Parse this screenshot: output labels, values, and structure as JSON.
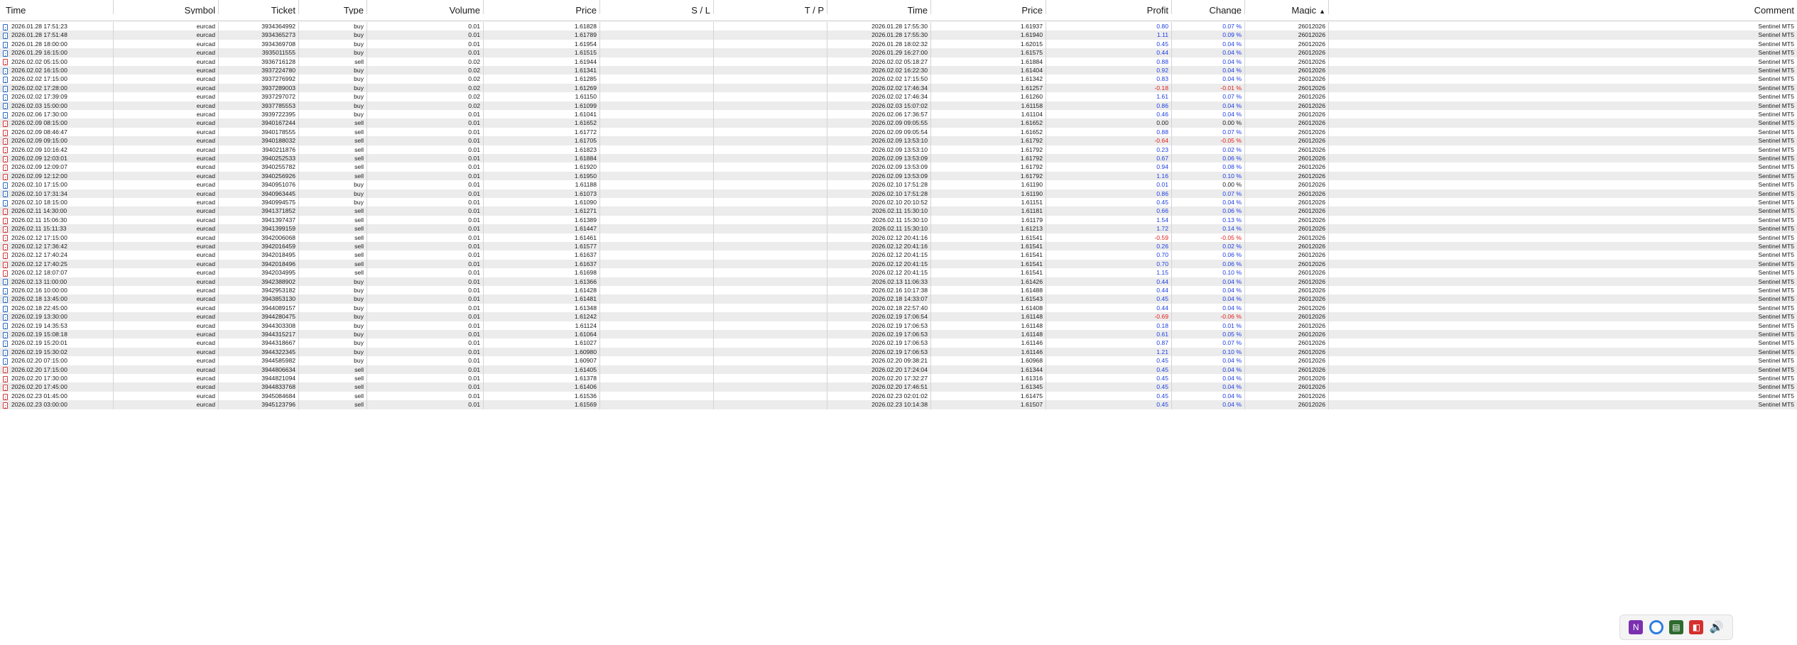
{
  "columns": {
    "time": "Time",
    "symbol": "Symbol",
    "ticket": "Ticket",
    "type": "Type",
    "volume": "Volume",
    "price": "Price",
    "sl": "S / L",
    "tp": "T / P",
    "close_time": "Time",
    "close_price": "Price",
    "profit": "Profit",
    "change": "Change",
    "magic": "Magic",
    "comment": "Comment",
    "sort_indicator": "▲"
  },
  "rows": [
    {
      "time": "2026.01.28 17:51:23",
      "symbol": "eurcad",
      "ticket": "3934364992",
      "type": "buy",
      "volume": "0.01",
      "price": "1.61828",
      "sl": "",
      "tp": "",
      "close_time": "2026.01.28 17:55:30",
      "close_price": "1.61937",
      "profit": "0.80",
      "change": "0.07 %",
      "magic": "26012026",
      "comment": "Sentinel MT5"
    },
    {
      "time": "2026.01.28 17:51:48",
      "symbol": "eurcad",
      "ticket": "3934365273",
      "type": "buy",
      "volume": "0.01",
      "price": "1.61789",
      "sl": "",
      "tp": "",
      "close_time": "2026.01.28 17:55:30",
      "close_price": "1.61940",
      "profit": "1.11",
      "change": "0.09 %",
      "magic": "26012026",
      "comment": "Sentinel MT5"
    },
    {
      "time": "2026.01.28 18:00:00",
      "symbol": "eurcad",
      "ticket": "3934369708",
      "type": "buy",
      "volume": "0.01",
      "price": "1.61954",
      "sl": "",
      "tp": "",
      "close_time": "2026.01.28 18:02:32",
      "close_price": "1.62015",
      "profit": "0.45",
      "change": "0.04 %",
      "magic": "26012026",
      "comment": "Sentinel MT5"
    },
    {
      "time": "2026.01.29 16:15:00",
      "symbol": "eurcad",
      "ticket": "3935011555",
      "type": "buy",
      "volume": "0.01",
      "price": "1.61515",
      "sl": "",
      "tp": "",
      "close_time": "2026.01.29 16:27:00",
      "close_price": "1.61575",
      "profit": "0.44",
      "change": "0.04 %",
      "magic": "26012026",
      "comment": "Sentinel MT5"
    },
    {
      "time": "2026.02.02 05:15:00",
      "symbol": "eurcad",
      "ticket": "3936716128",
      "type": "sell",
      "volume": "0.02",
      "price": "1.61944",
      "sl": "",
      "tp": "",
      "close_time": "2026.02.02 05:18:27",
      "close_price": "1.61884",
      "profit": "0.88",
      "change": "0.04 %",
      "magic": "26012026",
      "comment": "Sentinel MT5"
    },
    {
      "time": "2026.02.02 16:15:00",
      "symbol": "eurcad",
      "ticket": "3937224780",
      "type": "buy",
      "volume": "0.02",
      "price": "1.61341",
      "sl": "",
      "tp": "",
      "close_time": "2026.02.02 16:22:30",
      "close_price": "1.61404",
      "profit": "0.92",
      "change": "0.04 %",
      "magic": "26012026",
      "comment": "Sentinel MT5"
    },
    {
      "time": "2026.02.02 17:15:00",
      "symbol": "eurcad",
      "ticket": "3937276992",
      "type": "buy",
      "volume": "0.02",
      "price": "1.61285",
      "sl": "",
      "tp": "",
      "close_time": "2026.02.02 17:15:50",
      "close_price": "1.61342",
      "profit": "0.83",
      "change": "0.04 %",
      "magic": "26012026",
      "comment": "Sentinel MT5"
    },
    {
      "time": "2026.02.02 17:28:00",
      "symbol": "eurcad",
      "ticket": "3937289003",
      "type": "buy",
      "volume": "0.02",
      "price": "1.61269",
      "sl": "",
      "tp": "",
      "close_time": "2026.02.02 17:46:34",
      "close_price": "1.61257",
      "profit": "-0.18",
      "change": "-0.01 %",
      "magic": "26012026",
      "comment": "Sentinel MT5"
    },
    {
      "time": "2026.02.02 17:39:09",
      "symbol": "eurcad",
      "ticket": "3937297072",
      "type": "buy",
      "volume": "0.02",
      "price": "1.61150",
      "sl": "",
      "tp": "",
      "close_time": "2026.02.02 17:46:34",
      "close_price": "1.61260",
      "profit": "1.61",
      "change": "0.07 %",
      "magic": "26012026",
      "comment": "Sentinel MT5"
    },
    {
      "time": "2026.02.03 15:00:00",
      "symbol": "eurcad",
      "ticket": "3937785553",
      "type": "buy",
      "volume": "0.02",
      "price": "1.61099",
      "sl": "",
      "tp": "",
      "close_time": "2026.02.03 15:07:02",
      "close_price": "1.61158",
      "profit": "0.86",
      "change": "0.04 %",
      "magic": "26012026",
      "comment": "Sentinel MT5"
    },
    {
      "time": "2026.02.06 17:30:00",
      "symbol": "eurcad",
      "ticket": "3939722395",
      "type": "buy",
      "volume": "0.01",
      "price": "1.61041",
      "sl": "",
      "tp": "",
      "close_time": "2026.02.06 17:36:57",
      "close_price": "1.61104",
      "profit": "0.46",
      "change": "0.04 %",
      "magic": "26012026",
      "comment": "Sentinel MT5"
    },
    {
      "time": "2026.02.09 08:15:00",
      "symbol": "eurcad",
      "ticket": "3940167244",
      "type": "sell",
      "volume": "0.01",
      "price": "1.61652",
      "sl": "",
      "tp": "",
      "close_time": "2026.02.09 09:05:55",
      "close_price": "1.61652",
      "profit": "0.00",
      "change": "0.00 %",
      "magic": "26012026",
      "comment": "Sentinel MT5"
    },
    {
      "time": "2026.02.09 08:46:47",
      "symbol": "eurcad",
      "ticket": "3940178555",
      "type": "sell",
      "volume": "0.01",
      "price": "1.61772",
      "sl": "",
      "tp": "",
      "close_time": "2026.02.09 09:05:54",
      "close_price": "1.61652",
      "profit": "0.88",
      "change": "0.07 %",
      "magic": "26012026",
      "comment": "Sentinel MT5"
    },
    {
      "time": "2026.02.09 09:15:00",
      "symbol": "eurcad",
      "ticket": "3940188032",
      "type": "sell",
      "volume": "0.01",
      "price": "1.61705",
      "sl": "",
      "tp": "",
      "close_time": "2026.02.09 13:53:10",
      "close_price": "1.61792",
      "profit": "-0.64",
      "change": "-0.05 %",
      "magic": "26012026",
      "comment": "Sentinel MT5"
    },
    {
      "time": "2026.02.09 10:16:42",
      "symbol": "eurcad",
      "ticket": "3940211876",
      "type": "sell",
      "volume": "0.01",
      "price": "1.61823",
      "sl": "",
      "tp": "",
      "close_time": "2026.02.09 13:53:10",
      "close_price": "1.61792",
      "profit": "0.23",
      "change": "0.02 %",
      "magic": "26012026",
      "comment": "Sentinel MT5"
    },
    {
      "time": "2026.02.09 12:03:01",
      "symbol": "eurcad",
      "ticket": "3940252533",
      "type": "sell",
      "volume": "0.01",
      "price": "1.61884",
      "sl": "",
      "tp": "",
      "close_time": "2026.02.09 13:53:09",
      "close_price": "1.61792",
      "profit": "0.67",
      "change": "0.06 %",
      "magic": "26012026",
      "comment": "Sentinel MT5"
    },
    {
      "time": "2026.02.09 12:09:07",
      "symbol": "eurcad",
      "ticket": "3940255782",
      "type": "sell",
      "volume": "0.01",
      "price": "1.61920",
      "sl": "",
      "tp": "",
      "close_time": "2026.02.09 13:53:09",
      "close_price": "1.61792",
      "profit": "0.94",
      "change": "0.08 %",
      "magic": "26012026",
      "comment": "Sentinel MT5"
    },
    {
      "time": "2026.02.09 12:12:00",
      "symbol": "eurcad",
      "ticket": "3940256926",
      "type": "sell",
      "volume": "0.01",
      "price": "1.61950",
      "sl": "",
      "tp": "",
      "close_time": "2026.02.09 13:53:09",
      "close_price": "1.61792",
      "profit": "1.16",
      "change": "0.10 %",
      "magic": "26012026",
      "comment": "Sentinel MT5"
    },
    {
      "time": "2026.02.10 17:15:00",
      "symbol": "eurcad",
      "ticket": "3940951076",
      "type": "buy",
      "volume": "0.01",
      "price": "1.61188",
      "sl": "",
      "tp": "",
      "close_time": "2026.02.10 17:51:28",
      "close_price": "1.61190",
      "profit": "0.01",
      "change": "0.00 %",
      "magic": "26012026",
      "comment": "Sentinel MT5"
    },
    {
      "time": "2026.02.10 17:31:34",
      "symbol": "eurcad",
      "ticket": "3940963445",
      "type": "buy",
      "volume": "0.01",
      "price": "1.61073",
      "sl": "",
      "tp": "",
      "close_time": "2026.02.10 17:51:28",
      "close_price": "1.61190",
      "profit": "0.86",
      "change": "0.07 %",
      "magic": "26012026",
      "comment": "Sentinel MT5"
    },
    {
      "time": "2026.02.10 18:15:00",
      "symbol": "eurcad",
      "ticket": "3940994575",
      "type": "buy",
      "volume": "0.01",
      "price": "1.61090",
      "sl": "",
      "tp": "",
      "close_time": "2026.02.10 20:10:52",
      "close_price": "1.61151",
      "profit": "0.45",
      "change": "0.04 %",
      "magic": "26012026",
      "comment": "Sentinel MT5"
    },
    {
      "time": "2026.02.11 14:30:00",
      "symbol": "eurcad",
      "ticket": "3941371852",
      "type": "sell",
      "volume": "0.01",
      "price": "1.61271",
      "sl": "",
      "tp": "",
      "close_time": "2026.02.11 15:30:10",
      "close_price": "1.61181",
      "profit": "0.66",
      "change": "0.06 %",
      "magic": "26012026",
      "comment": "Sentinel MT5"
    },
    {
      "time": "2026.02.11 15:06:30",
      "symbol": "eurcad",
      "ticket": "3941397437",
      "type": "sell",
      "volume": "0.01",
      "price": "1.61389",
      "sl": "",
      "tp": "",
      "close_time": "2026.02.11 15:30:10",
      "close_price": "1.61179",
      "profit": "1.54",
      "change": "0.13 %",
      "magic": "26012026",
      "comment": "Sentinel MT5"
    },
    {
      "time": "2026.02.11 15:11:33",
      "symbol": "eurcad",
      "ticket": "3941399159",
      "type": "sell",
      "volume": "0.01",
      "price": "1.61447",
      "sl": "",
      "tp": "",
      "close_time": "2026.02.11 15:30:10",
      "close_price": "1.61213",
      "profit": "1.72",
      "change": "0.14 %",
      "magic": "26012026",
      "comment": "Sentinel MT5"
    },
    {
      "time": "2026.02.12 17:15:00",
      "symbol": "eurcad",
      "ticket": "3942006068",
      "type": "sell",
      "volume": "0.01",
      "price": "1.61461",
      "sl": "",
      "tp": "",
      "close_time": "2026.02.12 20:41:16",
      "close_price": "1.61541",
      "profit": "-0.59",
      "change": "-0.05 %",
      "magic": "26012026",
      "comment": "Sentinel MT5"
    },
    {
      "time": "2026.02.12 17:36:42",
      "symbol": "eurcad",
      "ticket": "3942016459",
      "type": "sell",
      "volume": "0.01",
      "price": "1.61577",
      "sl": "",
      "tp": "",
      "close_time": "2026.02.12 20:41:16",
      "close_price": "1.61541",
      "profit": "0.26",
      "change": "0.02 %",
      "magic": "26012026",
      "comment": "Sentinel MT5"
    },
    {
      "time": "2026.02.12 17:40:24",
      "symbol": "eurcad",
      "ticket": "3942018495",
      "type": "sell",
      "volume": "0.01",
      "price": "1.61637",
      "sl": "",
      "tp": "",
      "close_time": "2026.02.12 20:41:15",
      "close_price": "1.61541",
      "profit": "0.70",
      "change": "0.06 %",
      "magic": "26012026",
      "comment": "Sentinel MT5"
    },
    {
      "time": "2026.02.12 17:40:25",
      "symbol": "eurcad",
      "ticket": "3942018496",
      "type": "sell",
      "volume": "0.01",
      "price": "1.61637",
      "sl": "",
      "tp": "",
      "close_time": "2026.02.12 20:41:15",
      "close_price": "1.61541",
      "profit": "0.70",
      "change": "0.06 %",
      "magic": "26012026",
      "comment": "Sentinel MT5"
    },
    {
      "time": "2026.02.12 18:07:07",
      "symbol": "eurcad",
      "ticket": "3942034995",
      "type": "sell",
      "volume": "0.01",
      "price": "1.61698",
      "sl": "",
      "tp": "",
      "close_time": "2026.02.12 20:41:15",
      "close_price": "1.61541",
      "profit": "1.15",
      "change": "0.10 %",
      "magic": "26012026",
      "comment": "Sentinel MT5"
    },
    {
      "time": "2026.02.13 11:00:00",
      "symbol": "eurcad",
      "ticket": "3942388902",
      "type": "buy",
      "volume": "0.01",
      "price": "1.61366",
      "sl": "",
      "tp": "",
      "close_time": "2026.02.13 11:06:33",
      "close_price": "1.61426",
      "profit": "0.44",
      "change": "0.04 %",
      "magic": "26012026",
      "comment": "Sentinel MT5"
    },
    {
      "time": "2026.02.16 10:00:00",
      "symbol": "eurcad",
      "ticket": "3942953182",
      "type": "buy",
      "volume": "0.01",
      "price": "1.61428",
      "sl": "",
      "tp": "",
      "close_time": "2026.02.16 10:17:38",
      "close_price": "1.61488",
      "profit": "0.44",
      "change": "0.04 %",
      "magic": "26012026",
      "comment": "Sentinel MT5"
    },
    {
      "time": "2026.02.18 13:45:00",
      "symbol": "eurcad",
      "ticket": "3943853130",
      "type": "buy",
      "volume": "0.01",
      "price": "1.61481",
      "sl": "",
      "tp": "",
      "close_time": "2026.02.18 14:33:07",
      "close_price": "1.61543",
      "profit": "0.45",
      "change": "0.04 %",
      "magic": "26012026",
      "comment": "Sentinel MT5"
    },
    {
      "time": "2026.02.18 22:45:00",
      "symbol": "eurcad",
      "ticket": "3944089157",
      "type": "buy",
      "volume": "0.01",
      "price": "1.61348",
      "sl": "",
      "tp": "",
      "close_time": "2026.02.18 22:57:40",
      "close_price": "1.61408",
      "profit": "0.44",
      "change": "0.04 %",
      "magic": "26012026",
      "comment": "Sentinel MT5"
    },
    {
      "time": "2026.02.19 13:30:00",
      "symbol": "eurcad",
      "ticket": "3944280475",
      "type": "buy",
      "volume": "0.01",
      "price": "1.61242",
      "sl": "",
      "tp": "",
      "close_time": "2026.02.19 17:06:54",
      "close_price": "1.61148",
      "profit": "-0.69",
      "change": "-0.06 %",
      "magic": "26012026",
      "comment": "Sentinel MT5"
    },
    {
      "time": "2026.02.19 14:35:53",
      "symbol": "eurcad",
      "ticket": "3944303308",
      "type": "buy",
      "volume": "0.01",
      "price": "1.61124",
      "sl": "",
      "tp": "",
      "close_time": "2026.02.19 17:06:53",
      "close_price": "1.61148",
      "profit": "0.18",
      "change": "0.01 %",
      "magic": "26012026",
      "comment": "Sentinel MT5"
    },
    {
      "time": "2026.02.19 15:08:18",
      "symbol": "eurcad",
      "ticket": "3944315217",
      "type": "buy",
      "volume": "0.01",
      "price": "1.61064",
      "sl": "",
      "tp": "",
      "close_time": "2026.02.19 17:06:53",
      "close_price": "1.61148",
      "profit": "0.61",
      "change": "0.05 %",
      "magic": "26012026",
      "comment": "Sentinel MT5"
    },
    {
      "time": "2026.02.19 15:20:01",
      "symbol": "eurcad",
      "ticket": "3944318667",
      "type": "buy",
      "volume": "0.01",
      "price": "1.61027",
      "sl": "",
      "tp": "",
      "close_time": "2026.02.19 17:06:53",
      "close_price": "1.61146",
      "profit": "0.87",
      "change": "0.07 %",
      "magic": "26012026",
      "comment": "Sentinel MT5"
    },
    {
      "time": "2026.02.19 15:30:02",
      "symbol": "eurcad",
      "ticket": "3944322345",
      "type": "buy",
      "volume": "0.01",
      "price": "1.60980",
      "sl": "",
      "tp": "",
      "close_time": "2026.02.19 17:06:53",
      "close_price": "1.61146",
      "profit": "1.21",
      "change": "0.10 %",
      "magic": "26012026",
      "comment": "Sentinel MT5"
    },
    {
      "time": "2026.02.20 07:15:00",
      "symbol": "eurcad",
      "ticket": "3944585982",
      "type": "buy",
      "volume": "0.01",
      "price": "1.60907",
      "sl": "",
      "tp": "",
      "close_time": "2026.02.20 09:38:21",
      "close_price": "1.60968",
      "profit": "0.45",
      "change": "0.04 %",
      "magic": "26012026",
      "comment": "Sentinel MT5"
    },
    {
      "time": "2026.02.20 17:15:00",
      "symbol": "eurcad",
      "ticket": "3944806634",
      "type": "sell",
      "volume": "0.01",
      "price": "1.61405",
      "sl": "",
      "tp": "",
      "close_time": "2026.02.20 17:24:04",
      "close_price": "1.61344",
      "profit": "0.45",
      "change": "0.04 %",
      "magic": "26012026",
      "comment": "Sentinel MT5"
    },
    {
      "time": "2026.02.20 17:30:00",
      "symbol": "eurcad",
      "ticket": "3944821094",
      "type": "sell",
      "volume": "0.01",
      "price": "1.61378",
      "sl": "",
      "tp": "",
      "close_time": "2026.02.20 17:32:27",
      "close_price": "1.61316",
      "profit": "0.45",
      "change": "0.04 %",
      "magic": "26012026",
      "comment": "Sentinel MT5"
    },
    {
      "time": "2026.02.20 17:45:00",
      "symbol": "eurcad",
      "ticket": "3944833768",
      "type": "sell",
      "volume": "0.01",
      "price": "1.61406",
      "sl": "",
      "tp": "",
      "close_time": "2026.02.20 17:46:51",
      "close_price": "1.61345",
      "profit": "0.45",
      "change": "0.04 %",
      "magic": "26012026",
      "comment": "Sentinel MT5"
    },
    {
      "time": "2026.02.23 01:45:00",
      "symbol": "eurcad",
      "ticket": "3945084684",
      "type": "sell",
      "volume": "0.01",
      "price": "1.61536",
      "sl": "",
      "tp": "",
      "close_time": "2026.02.23 02:01:02",
      "close_price": "1.61475",
      "profit": "0.45",
      "change": "0.04 %",
      "magic": "26012026",
      "comment": "Sentinel MT5"
    },
    {
      "time": "2026.02.23 03:00:00",
      "symbol": "eurcad",
      "ticket": "3945123796",
      "type": "sell",
      "volume": "0.01",
      "price": "1.61569",
      "sl": "",
      "tp": "",
      "close_time": "2026.02.23 10:14:38",
      "close_price": "1.61507",
      "profit": "0.45",
      "change": "0.04 %",
      "magic": "26012026",
      "comment": "Sentinel MT5"
    }
  ],
  "colors": {
    "profit_positive": "#1c3ee0",
    "profit_negative": "#e0201c",
    "row_alt": "#ececec",
    "buy_icon": "#2b6cc4",
    "sell_icon": "#d23a3a"
  },
  "tray": [
    {
      "icon": "onenote-icon"
    },
    {
      "icon": "chrome-icon"
    },
    {
      "icon": "terminal-icon"
    },
    {
      "icon": "red-app-icon"
    },
    {
      "icon": "volume-icon"
    }
  ]
}
